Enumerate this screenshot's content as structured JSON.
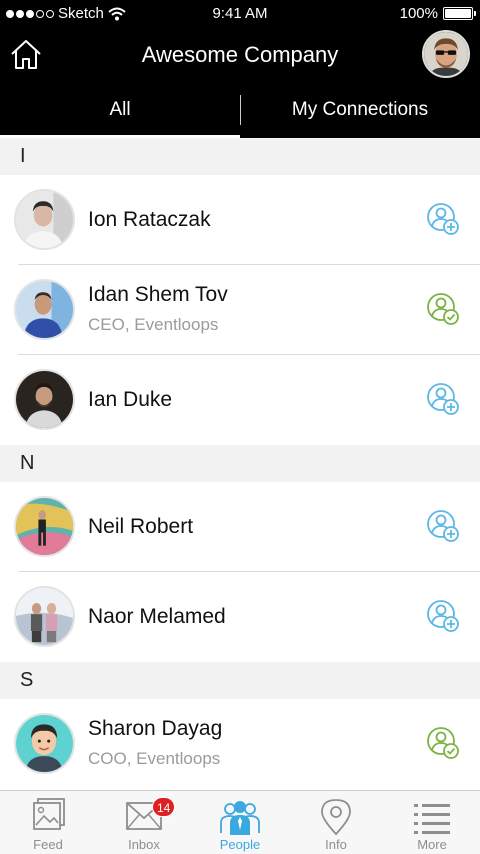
{
  "status_bar": {
    "carrier": "Sketch",
    "time": "9:41 AM",
    "battery": "100%"
  },
  "header": {
    "title": "Awesome Company",
    "home_icon": "home-icon"
  },
  "tabs": [
    {
      "label": "All",
      "active": true
    },
    {
      "label": "My Connections",
      "active": false
    }
  ],
  "sections": [
    {
      "letter": "I",
      "people": [
        {
          "name": "Ion Rataczak",
          "subtitle": "",
          "status": "add-connection"
        },
        {
          "name": "Idan Shem Tov",
          "subtitle": "CEO, Eventloops",
          "status": "connected"
        },
        {
          "name": "Ian Duke",
          "subtitle": "",
          "status": "add-connection"
        }
      ]
    },
    {
      "letter": "N",
      "people": [
        {
          "name": "Neil Robert",
          "subtitle": "",
          "status": "add-connection"
        },
        {
          "name": "Naor Melamed",
          "subtitle": "",
          "status": "add-connection"
        }
      ]
    },
    {
      "letter": "S",
      "people": [
        {
          "name": "Sharon Dayag",
          "subtitle": "COO, Eventloops",
          "status": "connected"
        }
      ]
    }
  ],
  "tabbar": {
    "items": [
      {
        "label": "Feed",
        "icon": "feed-icon"
      },
      {
        "label": "Inbox",
        "icon": "inbox-icon",
        "badge": "14"
      },
      {
        "label": "People",
        "icon": "people-icon",
        "active": true
      },
      {
        "label": "Info",
        "icon": "map-pin-icon"
      },
      {
        "label": "More",
        "icon": "list-icon"
      }
    ]
  },
  "colors": {
    "add_connection": "#5bb8e6",
    "connected": "#7cb342",
    "active_tab": "#3aa9de",
    "header_bg": "#000000",
    "badge": "#e02020"
  }
}
